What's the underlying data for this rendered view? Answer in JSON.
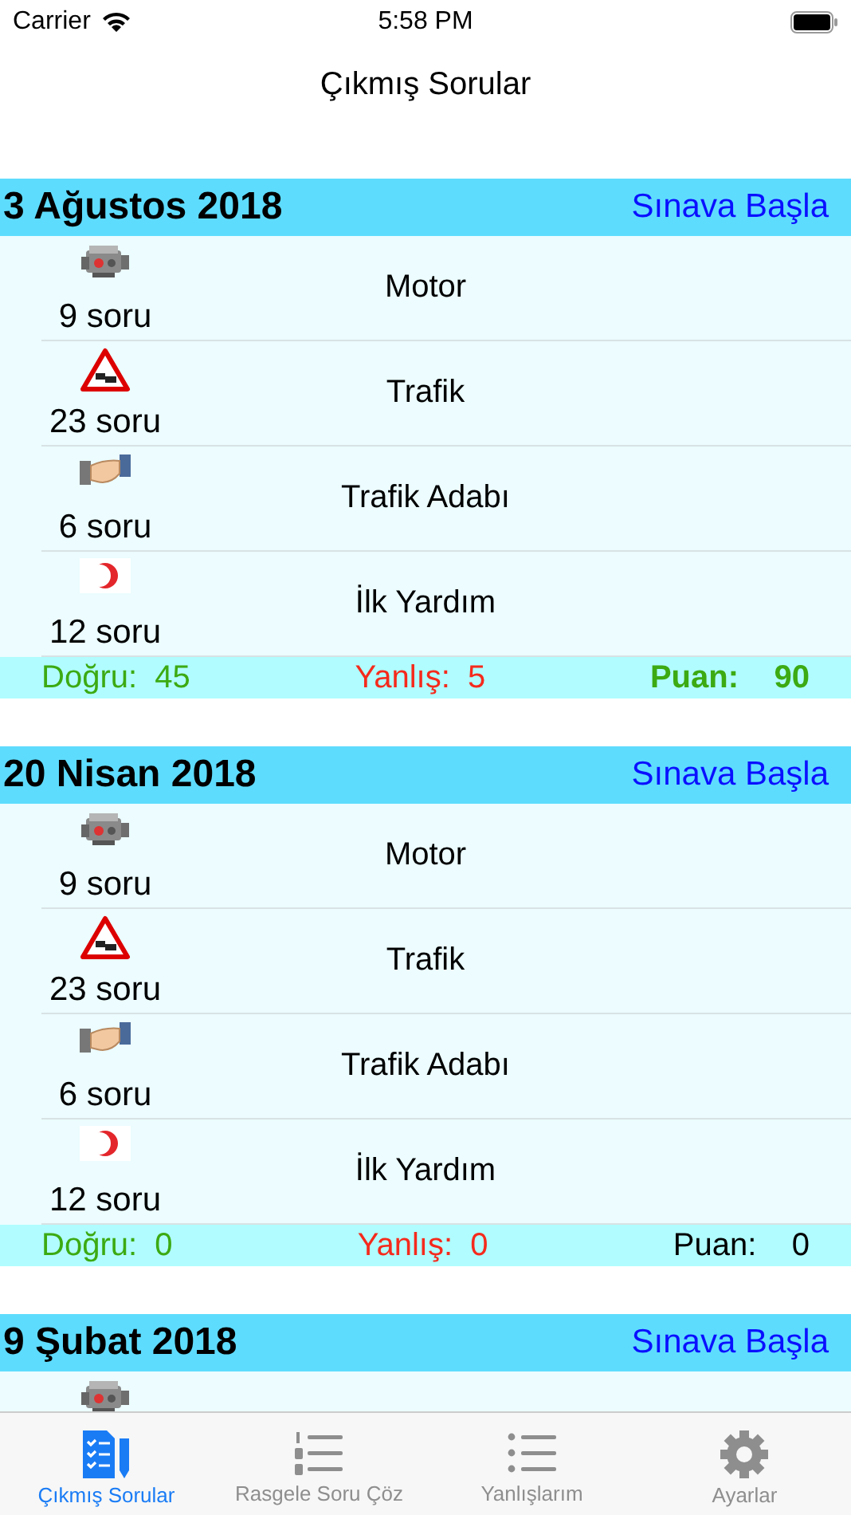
{
  "status_bar": {
    "carrier": "Carrier",
    "time": "5:58 PM"
  },
  "nav": {
    "title": "Çıkmış Sorular"
  },
  "exams": [
    {
      "date": "3 Ağustos 2018",
      "action": "Sınava Başla",
      "passed": true,
      "categories": [
        {
          "kind": "motor",
          "count": "9 soru",
          "name": "Motor"
        },
        {
          "kind": "traffic",
          "count": "23 soru",
          "name": "Trafik"
        },
        {
          "kind": "manners",
          "count": "6 soru",
          "name": "Trafik Adabı"
        },
        {
          "kind": "firstaid",
          "count": "12 soru",
          "name": "İlk Yardım"
        }
      ],
      "stats": {
        "correct_label": "Doğru:",
        "correct": "45",
        "wrong_label": "Yanlış:",
        "wrong": "5",
        "score_label": "Puan:",
        "score": "90"
      }
    },
    {
      "date": "20 Nisan 2018",
      "action": "Sınava Başla",
      "passed": false,
      "categories": [
        {
          "kind": "motor",
          "count": "9 soru",
          "name": "Motor"
        },
        {
          "kind": "traffic",
          "count": "23 soru",
          "name": "Trafik"
        },
        {
          "kind": "manners",
          "count": "6 soru",
          "name": "Trafik Adabı"
        },
        {
          "kind": "firstaid",
          "count": "12 soru",
          "name": "İlk Yardım"
        }
      ],
      "stats": {
        "correct_label": "Doğru:",
        "correct": "0",
        "wrong_label": "Yanlış:",
        "wrong": "0",
        "score_label": "Puan:",
        "score": "0"
      }
    },
    {
      "date": "9 Şubat 2018",
      "action": "Sınava Başla",
      "categories": [
        {
          "kind": "motor"
        }
      ]
    }
  ],
  "tabs": [
    {
      "kind": "checklist",
      "label": "Çıkmış Sorular",
      "selected": true
    },
    {
      "kind": "numbered",
      "label": "Rasgele Soru Çöz",
      "selected": false
    },
    {
      "kind": "bullets",
      "label": "Yanlışlarım",
      "selected": false
    },
    {
      "kind": "gear",
      "label": "Ayarlar",
      "selected": false
    }
  ]
}
